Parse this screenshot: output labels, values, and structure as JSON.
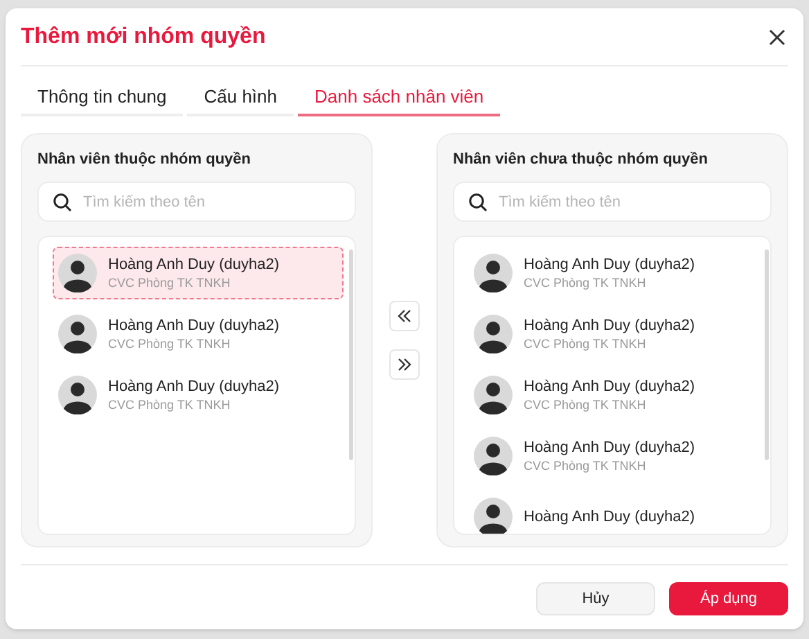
{
  "dialog": {
    "title": "Thêm mới nhóm quyền"
  },
  "tabs": [
    {
      "label": "Thông tin chung",
      "selected": false
    },
    {
      "label": "Cấu hình",
      "selected": false
    },
    {
      "label": "Danh sách nhân viên",
      "selected": true
    }
  ],
  "panels": [
    {
      "heading": "Nhân viên thuộc nhóm quyền",
      "search": {
        "placeholder": "Tìm kiếm theo tên"
      },
      "items": [
        {
          "name": "Hoàng Anh Duy (duyha2)",
          "subtitle": "CVC Phòng TK TNKH",
          "selected": true
        },
        {
          "name": "Hoàng Anh Duy (duyha2)",
          "subtitle": "CVC Phòng TK TNKH",
          "selected": false
        },
        {
          "name": "Hoàng Anh Duy (duyha2)",
          "subtitle": "CVC Phòng TK TNKH",
          "selected": false
        }
      ]
    },
    {
      "heading": "Nhân viên chưa thuộc nhóm quyền",
      "search": {
        "placeholder": "Tìm kiếm theo tên"
      },
      "items": [
        {
          "name": "Hoàng Anh Duy (duyha2)",
          "subtitle": "CVC Phòng TK TNKH",
          "selected": false
        },
        {
          "name": "Hoàng Anh Duy (duyha2)",
          "subtitle": "CVC Phòng TK TNKH",
          "selected": false
        },
        {
          "name": "Hoàng Anh Duy (duyha2)",
          "subtitle": "CVC Phòng TK TNKH",
          "selected": false
        },
        {
          "name": "Hoàng Anh Duy (duyha2)",
          "subtitle": "CVC Phòng TK TNKH",
          "selected": false
        },
        {
          "name": "Hoàng Anh Duy (duyha2)",
          "selected": false
        }
      ]
    }
  ],
  "buttons": [
    {
      "label": "Hủy",
      "kind": "secondary"
    },
    {
      "label": "Áp dụng",
      "kind": "primary"
    }
  ]
}
